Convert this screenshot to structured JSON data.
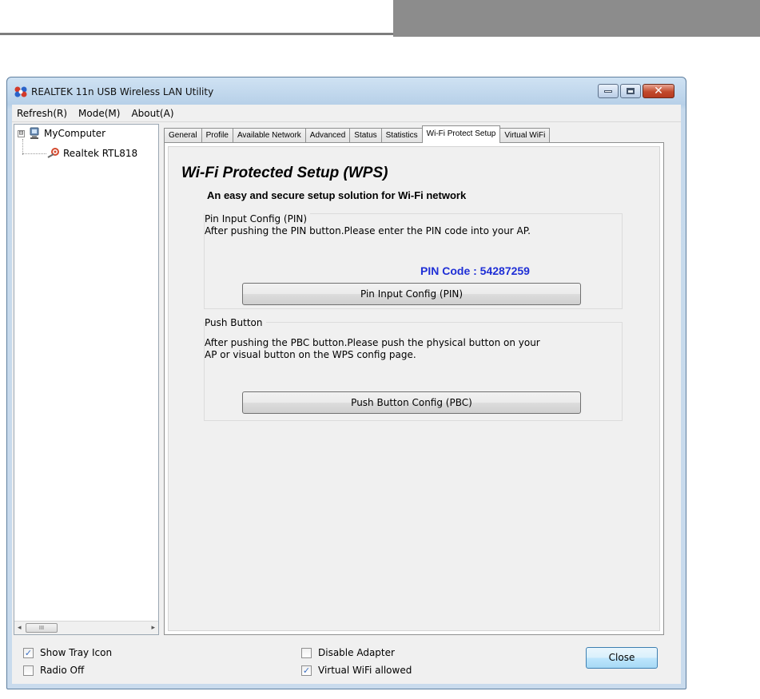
{
  "window": {
    "title": "REALTEK 11n USB Wireless LAN Utility"
  },
  "menu": [
    "Refresh(R)",
    "Mode(M)",
    "About(A)"
  ],
  "tree": {
    "root": "MyComputer",
    "child": "Realtek RTL818",
    "root_expander": "⊟",
    "scroll_thumb": "III"
  },
  "tabs": [
    "General",
    "Profile",
    "Available Network",
    "Advanced",
    "Status",
    "Statistics",
    "Wi-Fi Protect Setup",
    "Virtual WiFi"
  ],
  "active_tab": "Wi-Fi Protect Setup",
  "wps": {
    "title": "Wi-Fi Protected Setup (WPS)",
    "subtitle": "An easy and secure setup solution for Wi-Fi network",
    "pin_group": {
      "title": "Pin Input Config (PIN)",
      "text": "After pushing the PIN button.Please enter the PIN code into your AP.",
      "pin_code": "PIN Code :  54287259",
      "button": "Pin Input Config (PIN)"
    },
    "pbc_group": {
      "title": "Push Button",
      "text_line1": "After pushing the PBC button.Please push the physical button on your",
      "text_line2": "AP or visual button on the WPS config page.",
      "button": "Push Button Config (PBC)"
    }
  },
  "bottom": {
    "show_tray_icon": {
      "label": "Show Tray Icon",
      "checked": true
    },
    "radio_off": {
      "label": "Radio Off",
      "checked": false
    },
    "disable_adapter": {
      "label": "Disable Adapter",
      "checked": false
    },
    "virtual_wifi_allowed": {
      "label": "Virtual WiFi allowed",
      "checked": true
    },
    "close_button": "Close"
  },
  "icons": {
    "app": "realtek-app-icon",
    "computer": "computer-icon",
    "adapter": "wireless-adapter-icon",
    "check_mark": "✓",
    "close_glyph": "✕",
    "scroll_left": "◂",
    "scroll_right": "▸"
  }
}
